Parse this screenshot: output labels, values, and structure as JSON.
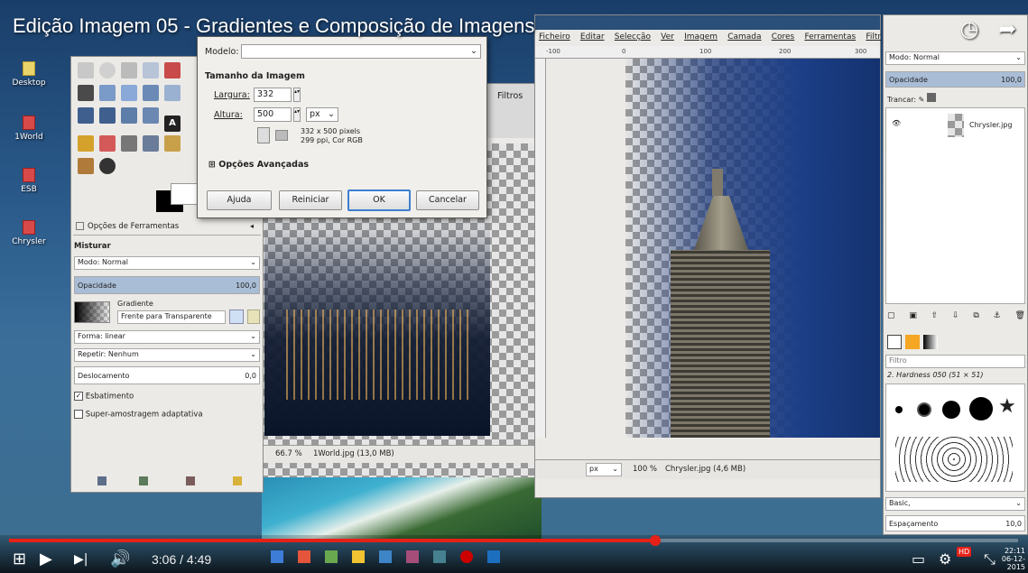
{
  "video": {
    "title": "Edição Imagem 05 - Gradientes e Composição de Imagens",
    "time_current": "3:06",
    "time_sep": " / ",
    "time_total": "4:49",
    "progress": 0.64,
    "hd_badge": "HD",
    "colors": {
      "progress": "#e62117"
    }
  },
  "desktop": {
    "icons": [
      {
        "label": "Desktop",
        "icon": "folder-icon"
      },
      {
        "label": "1World",
        "icon": "image-file-icon"
      },
      {
        "label": "ESB",
        "icon": "image-file-icon"
      },
      {
        "label": "Chrysler",
        "icon": "image-file-icon"
      }
    ]
  },
  "scale_dialog": {
    "modelo_label": "Modelo:",
    "section_title": "Tamanho da Imagem",
    "width_label": "Largura:",
    "width_value": "332",
    "height_label": "Altura:",
    "height_value": "500",
    "unit": "px",
    "info_line1": "332 x 500 pixels",
    "info_line2": "299 ppi, Cor RGB",
    "advanced": "Opções Avançadas",
    "btn_help": "Ajuda",
    "btn_reset": "Reiniciar",
    "btn_ok": "OK",
    "btn_cancel": "Cancelar"
  },
  "tool_options": {
    "tab_label": "Opções de Ferramentas",
    "section": "Misturar",
    "mode_label": "Modo:",
    "mode_value": "Normal",
    "opacity_label": "Opacidade",
    "opacity_value": "100,0",
    "gradient_label": "Gradiente",
    "gradient_value": "Frente para Transparente",
    "shape_label": "Forma:",
    "shape_value": "linear",
    "repeat_label": "Repetir:",
    "repeat_value": "Nenhum",
    "offset_label": "Deslocamento",
    "offset_value": "0,0",
    "dither_label": "Esbatimento",
    "supersample_label": "Super-amostragem adaptativa"
  },
  "world_window": {
    "menu_filters": "Filtros",
    "zoom": "66.7 %",
    "status": "1World.jpg (13,0 MB)"
  },
  "chrysler_window": {
    "menu": [
      "Ficheiro",
      "Editar",
      "Selecção",
      "Ver",
      "Imagem",
      "Camada",
      "Cores",
      "Ferramentas",
      "Filtr"
    ],
    "ruler_marks": [
      "-100",
      "0",
      "100",
      "200",
      "300"
    ],
    "unit": "px",
    "zoom": "100 %",
    "status": "Chrysler.jpg (4,6 MB)"
  },
  "layers_panel": {
    "mode_label": "Modo:",
    "mode_value": "Normal",
    "opacity_label": "Opacidade",
    "opacity_value": "100,0",
    "lock_label": "Trancar:",
    "layer_name": "Chrysler.jpg",
    "brush_filter": "Filtro",
    "brush_name": "2. Hardness 050 (51 × 51)",
    "preset": "Basic,",
    "spacing_label": "Espaçamento",
    "spacing_value": "10,0"
  },
  "taskbar": {
    "clock": "22:11",
    "date": "06-12-2015"
  }
}
